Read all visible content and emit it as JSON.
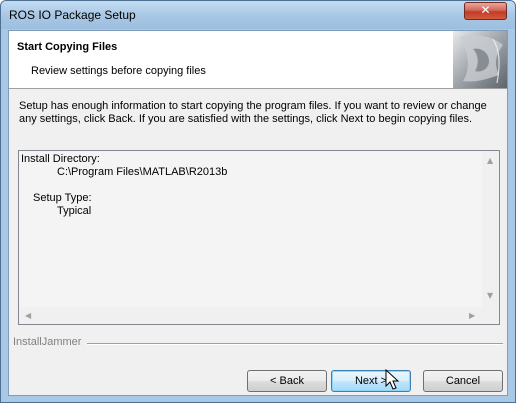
{
  "window": {
    "title": "ROS IO Package Setup",
    "close_glyph": "✕"
  },
  "header": {
    "title": "Start Copying Files",
    "subtitle": "Review settings before copying files"
  },
  "intro_text": "Setup has enough information to start copying the program files.  If you want to review or change any settings, click Back.  If you are satisfied with the settings, click Next to begin copying files.",
  "summary": {
    "install_dir_label": "Install Directory:",
    "install_dir_value": "C:\\Program Files\\MATLAB\\R2013b",
    "setup_type_label": "Setup Type:",
    "setup_type_value": "Typical"
  },
  "brand": "InstallJammer",
  "buttons": {
    "back": "< Back",
    "next": "Next >",
    "cancel": "Cancel"
  },
  "icons": {
    "close": "close-icon",
    "scroll_up": "scroll-up-icon",
    "scroll_down": "scroll-down-icon",
    "scroll_left": "scroll-left-icon",
    "scroll_right": "scroll-right-icon",
    "cursor": "mouse-pointer-icon"
  }
}
